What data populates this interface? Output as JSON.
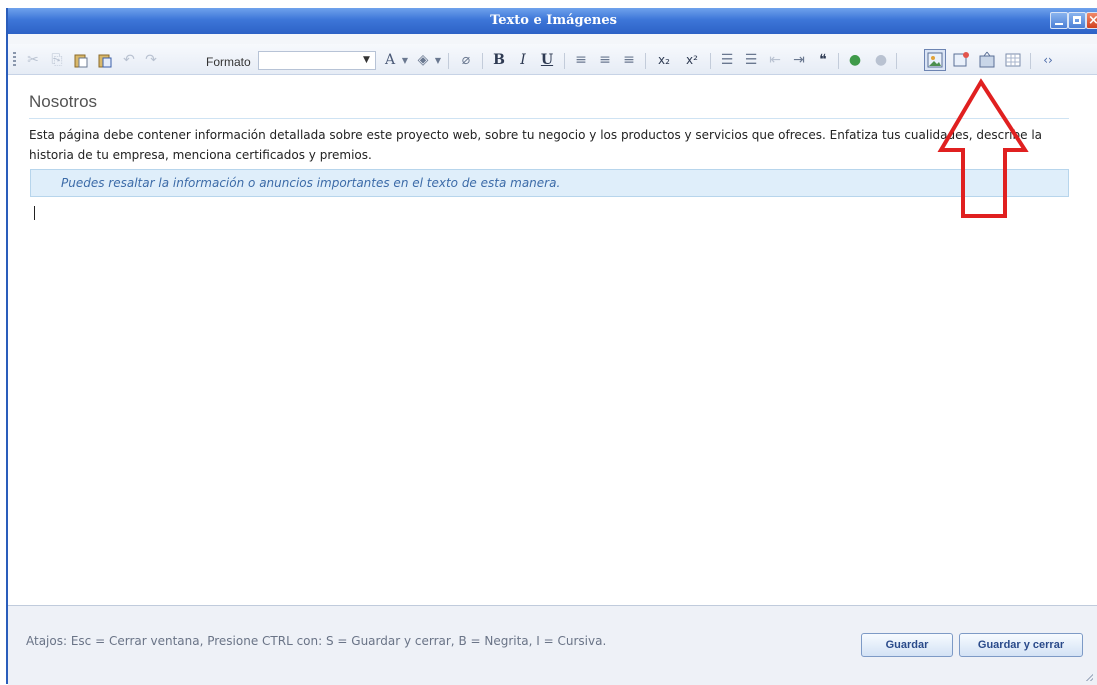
{
  "window": {
    "title": "Texto e Imágenes"
  },
  "toolbar": {
    "format_label": "Formato",
    "format_value": "",
    "buttons": [
      {
        "name": "cut-icon",
        "glyph": "✂"
      },
      {
        "name": "copy-icon",
        "glyph": "⎘"
      },
      {
        "name": "paste-icon",
        "glyph": "📋"
      },
      {
        "name": "paste-word-icon",
        "glyph": "📋"
      },
      {
        "name": "undo-icon",
        "glyph": "↶"
      },
      {
        "name": "redo-icon",
        "glyph": "↷"
      }
    ],
    "bold": "B",
    "italic": "I",
    "underline": "U",
    "subscript": "x₂",
    "superscript": "x²",
    "font_color_glyph": "A",
    "quote_glyph": "❝",
    "source_glyph": "‹›"
  },
  "editor": {
    "heading": "Nosotros",
    "paragraph": "Esta página debe contener información detallada sobre este proyecto web, sobre tu negocio y los productos y servicios que ofreces. Enfatiza tus cualidades, describe la historia de tu empresa, menciona certificados y premios.",
    "highlight": "Puedes resaltar la información o anuncios importantes en el texto de esta manera."
  },
  "footer": {
    "shortcuts": "Atajos: Esc = Cerrar ventana, Presione CTRL con: S = Guardar y cerrar, B = Negrita, I = Cursiva.",
    "save_label": "Guardar",
    "save_close_label": "Guardar y cerrar"
  },
  "colors": {
    "titlebar": "#3d76d8",
    "annotation_arrow": "#e02020",
    "highlight_bg": "#dfeefa"
  }
}
